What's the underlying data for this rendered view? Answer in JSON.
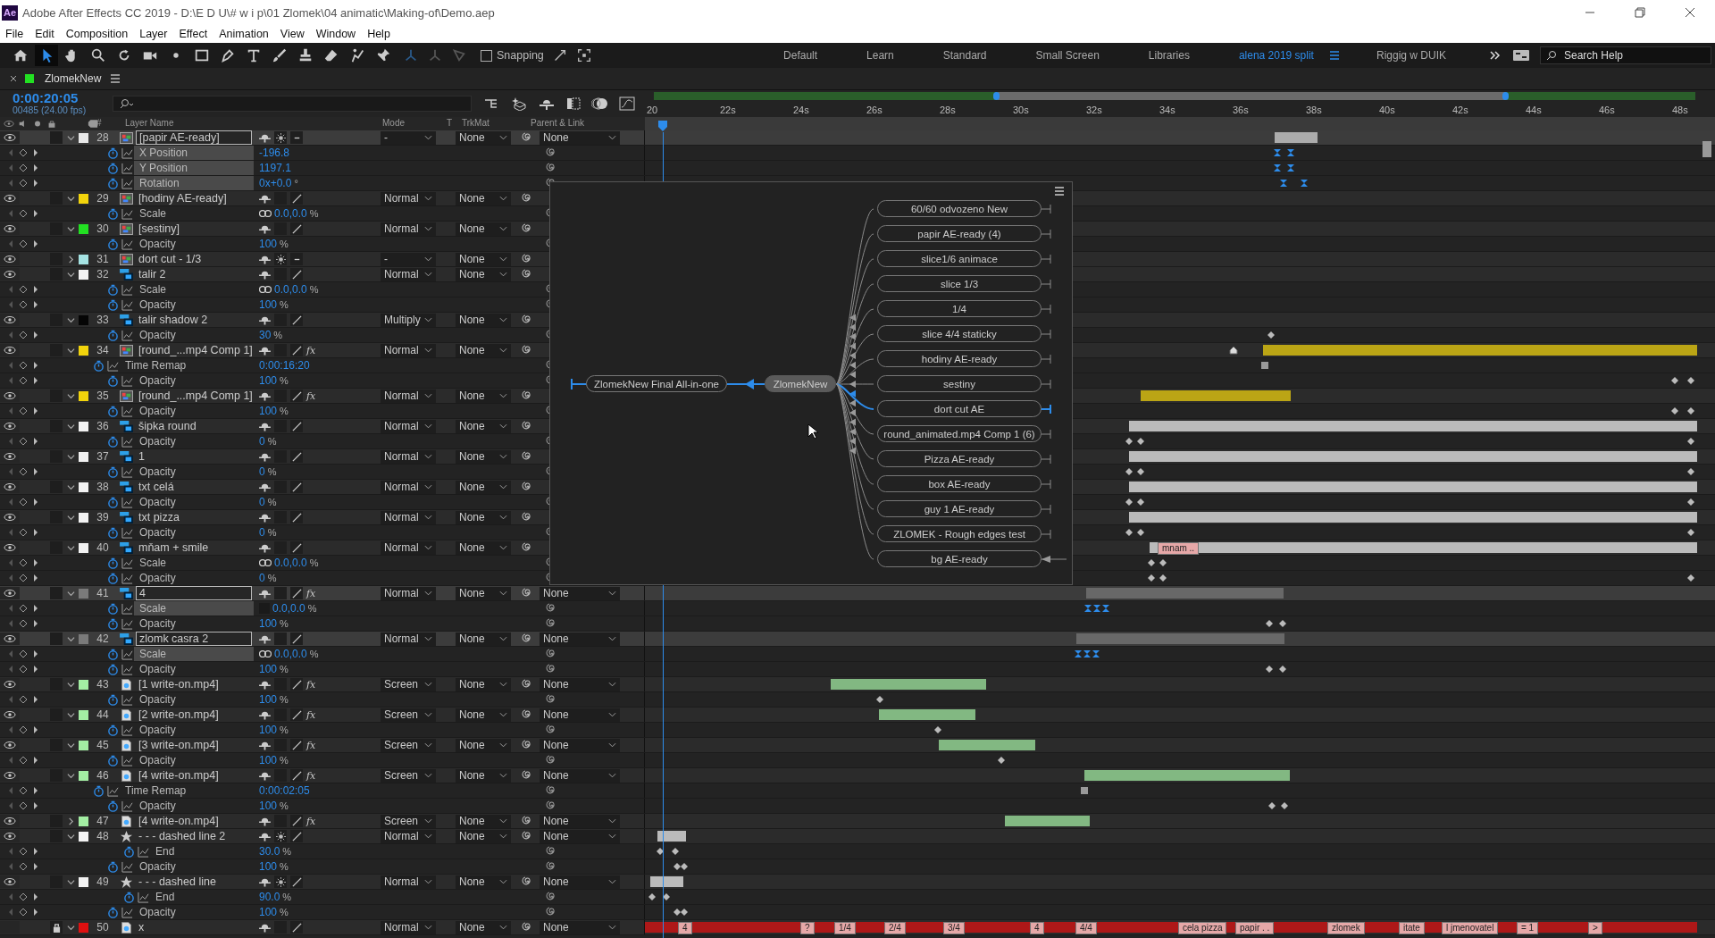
{
  "window": {
    "app_icon": "Ae",
    "title": "Adobe After Effects CC 2019 - D:\\E D U\\# w i p\\01 Zlomek\\04 animatic\\Making-of\\Demo.aep"
  },
  "menu": [
    "File",
    "Edit",
    "Composition",
    "Layer",
    "Effect",
    "Animation",
    "View",
    "Window",
    "Help"
  ],
  "tools": [
    {
      "kind": "home",
      "selected": false
    },
    {
      "kind": "select",
      "selected": true
    },
    {
      "kind": "hand",
      "selected": false
    },
    {
      "kind": "zoom",
      "selected": false
    },
    {
      "kind": "rotate",
      "selected": false
    },
    {
      "kind": "camera",
      "selected": false
    },
    {
      "kind": "pan",
      "selected": false
    },
    {
      "kind": "rectangle",
      "selected": false
    },
    {
      "kind": "pen",
      "selected": false
    },
    {
      "kind": "type",
      "selected": false
    },
    {
      "kind": "brush",
      "selected": false
    },
    {
      "kind": "stamp",
      "selected": false
    },
    {
      "kind": "eraser",
      "selected": false
    },
    {
      "kind": "roto",
      "selected": false
    },
    {
      "kind": "pin",
      "selected": false
    }
  ],
  "snapping": {
    "label": "Snapping",
    "checked": false
  },
  "workspaces": [
    {
      "label": "Default",
      "selected": false
    },
    {
      "label": "Learn",
      "selected": false
    },
    {
      "label": "Standard",
      "selected": false
    },
    {
      "label": "Small Screen",
      "selected": false
    },
    {
      "label": "Libraries",
      "selected": false
    },
    {
      "label": "alena 2019 split",
      "selected": true
    },
    {
      "label": "Riggig w DUIK",
      "selected": false
    }
  ],
  "search_help": {
    "placeholder": "Search Help"
  },
  "comp_tab": {
    "title": "ZlomekNew",
    "color": "#22e022"
  },
  "timecode": "0:00:20:05",
  "frames": "00485 (24.00 fps)",
  "columns": [
    "#",
    "Layer Name",
    "Mode",
    "T",
    "TrkMat",
    "Parent & Link"
  ],
  "ruler": [
    "20",
    "22s",
    "24s",
    "26s",
    "28s",
    "30s",
    "32s",
    "34s",
    "36s",
    "38s",
    "40s",
    "42s",
    "44s",
    "46s",
    "48s"
  ],
  "layers": [
    {
      "number": "28",
      "name": "[papir AE-ready]",
      "color": "#e8e8e8",
      "kind": "comp",
      "expanded": true,
      "visible": true,
      "locked": false,
      "selected": true,
      "collapse": true,
      "quality": false,
      "mode": "-",
      "trkmat": "None",
      "parent": "None",
      "properties": [
        {
          "name": "X Position",
          "kind": "transform",
          "value": "-196.8",
          "selected": true
        },
        {
          "name": "Y Position",
          "kind": "transform",
          "value": "1197.1",
          "selected": true
        },
        {
          "name": "Rotation",
          "kind": "transform",
          "value": "0x+0.0",
          "unit": "°",
          "selected": true
        }
      ]
    },
    {
      "number": "29",
      "name": "[hodiny AE-ready]",
      "color": "#f2d40c",
      "kind": "comp",
      "expanded": true,
      "visible": true,
      "locked": false,
      "selected": false,
      "collapse": false,
      "quality": true,
      "mode": "Normal",
      "trkmat": "None",
      "properties": [
        {
          "name": "Scale",
          "kind": "transform",
          "value": "0.0,0.0",
          "unit": "%",
          "linked": true,
          "selected": false
        }
      ]
    },
    {
      "number": "30",
      "name": "[sestiny]",
      "color": "#22e022",
      "kind": "comp",
      "expanded": true,
      "visible": true,
      "locked": false,
      "selected": false,
      "collapse": false,
      "quality": true,
      "mode": "Normal",
      "trkmat": "None",
      "properties": [
        {
          "name": "Opacity",
          "kind": "transform",
          "value": "100",
          "unit": "%",
          "selected": false
        }
      ]
    },
    {
      "number": "31",
      "name": "dort cut - 1/3",
      "color": "#a5e3e3",
      "kind": "comp",
      "expanded": false,
      "visible": true,
      "locked": false,
      "selected": false,
      "collapse": true,
      "quality": false,
      "mode": "-",
      "trkmat": "None"
    },
    {
      "number": "32",
      "name": "talir 2",
      "color": "#f2f2f2",
      "kind": "psd",
      "expanded": true,
      "visible": true,
      "locked": false,
      "selected": false,
      "collapse": false,
      "quality": true,
      "mode": "Normal",
      "trkmat": "None",
      "properties": [
        {
          "name": "Scale",
          "kind": "transform",
          "value": "0.0,0.0",
          "unit": "%",
          "linked": true,
          "selected": false
        },
        {
          "name": "Opacity",
          "kind": "transform",
          "value": "100",
          "unit": "%",
          "selected": false
        }
      ]
    },
    {
      "number": "33",
      "name": "talir shadow 2",
      "color": "#050505",
      "kind": "psd",
      "expanded": true,
      "visible": true,
      "locked": false,
      "selected": false,
      "collapse": false,
      "quality": true,
      "mode": "Multiply",
      "trkmat": "None",
      "properties": [
        {
          "name": "Opacity",
          "kind": "transform",
          "value": "30",
          "unit": "%",
          "selected": false
        }
      ]
    },
    {
      "number": "34",
      "name": "[round_...mp4 Comp 1]",
      "color": "#f2d40c",
      "kind": "comp",
      "expanded": true,
      "visible": true,
      "locked": false,
      "selected": false,
      "collapse": false,
      "quality": true,
      "fx": "fx",
      "mode": "Normal",
      "trkmat": "None",
      "properties": [
        {
          "name": "Time Remap",
          "kind": "remap",
          "value": "0:00:16:20",
          "selected": false
        },
        {
          "name": "Opacity",
          "kind": "transform",
          "value": "100",
          "unit": "%",
          "selected": false
        }
      ]
    },
    {
      "number": "35",
      "name": "[round_...mp4 Comp 1]",
      "color": "#f2d40c",
      "kind": "comp",
      "expanded": true,
      "visible": true,
      "locked": false,
      "selected": false,
      "collapse": false,
      "quality": true,
      "fx": "fx",
      "mode": "Normal",
      "trkmat": "None",
      "properties": [
        {
          "name": "Opacity",
          "kind": "transform",
          "value": "100",
          "unit": "%",
          "selected": false
        }
      ]
    },
    {
      "number": "36",
      "name": "šipka round",
      "color": "#f2f2f2",
      "kind": "psd",
      "expanded": true,
      "visible": true,
      "locked": false,
      "selected": false,
      "collapse": false,
      "quality": true,
      "mode": "Normal",
      "trkmat": "None",
      "properties": [
        {
          "name": "Opacity",
          "kind": "transform",
          "value": "0",
          "unit": "%",
          "selected": false
        }
      ]
    },
    {
      "number": "37",
      "name": "1",
      "color": "#f2f2f2",
      "kind": "psd",
      "expanded": true,
      "visible": true,
      "locked": false,
      "selected": false,
      "collapse": false,
      "quality": true,
      "mode": "Normal",
      "trkmat": "None",
      "properties": [
        {
          "name": "Opacity",
          "kind": "transform",
          "value": "0",
          "unit": "%",
          "selected": false
        }
      ]
    },
    {
      "number": "38",
      "name": "txt celá",
      "color": "#f2f2f2",
      "kind": "psd",
      "expanded": true,
      "visible": true,
      "locked": false,
      "selected": false,
      "collapse": false,
      "quality": true,
      "mode": "Normal",
      "trkmat": "None",
      "properties": [
        {
          "name": "Opacity",
          "kind": "transform",
          "value": "0",
          "unit": "%",
          "selected": false
        }
      ]
    },
    {
      "number": "39",
      "name": "txt pizza",
      "color": "#f2f2f2",
      "kind": "psd",
      "expanded": true,
      "visible": true,
      "locked": false,
      "selected": false,
      "collapse": false,
      "quality": true,
      "mode": "Normal",
      "trkmat": "None",
      "properties": [
        {
          "name": "Opacity",
          "kind": "transform",
          "value": "0",
          "unit": "%",
          "selected": false
        }
      ]
    },
    {
      "number": "40",
      "name": "mňam + smile",
      "color": "#f2f2f2",
      "kind": "psd",
      "expanded": true,
      "visible": true,
      "locked": false,
      "selected": false,
      "collapse": false,
      "quality": true,
      "mode": "Normal",
      "trkmat": "None",
      "markers": [
        "mnam .."
      ],
      "properties": [
        {
          "name": "Scale",
          "kind": "transform",
          "value": "0.0,0.0",
          "unit": "%",
          "linked": true,
          "selected": false
        },
        {
          "name": "Opacity",
          "kind": "transform",
          "value": "0",
          "unit": "%",
          "selected": false
        }
      ]
    },
    {
      "number": "41",
      "name": "4",
      "color": "#7a7a7a",
      "kind": "psd",
      "expanded": true,
      "visible": true,
      "locked": false,
      "selected": true,
      "collapse": false,
      "quality": true,
      "fx": "fx",
      "mode": "Normal",
      "trkmat": "None",
      "parent": "None",
      "properties": [
        {
          "name": "Scale",
          "kind": "transform",
          "value": "0.0,0.0",
          "unit": "%",
          "linked": false,
          "selected": true
        },
        {
          "name": "Opacity",
          "kind": "transform",
          "value": "100",
          "unit": "%",
          "selected": false
        }
      ]
    },
    {
      "number": "42",
      "name": "zlomk casra 2",
      "color": "#7a7a7a",
      "kind": "psd",
      "expanded": true,
      "visible": true,
      "locked": false,
      "selected": true,
      "collapse": false,
      "quality": true,
      "mode": "Normal",
      "trkmat": "None",
      "parent": "None",
      "properties": [
        {
          "name": "Scale",
          "kind": "transform",
          "value": "0.0,0.0",
          "unit": "%",
          "linked": true,
          "selected": true
        },
        {
          "name": "Opacity",
          "kind": "transform",
          "value": "100",
          "unit": "%",
          "selected": false
        }
      ]
    },
    {
      "number": "43",
      "name": "[1 write-on.mp4]",
      "color": "#a3eea3",
      "kind": "footage",
      "expanded": true,
      "visible": true,
      "locked": false,
      "selected": false,
      "collapse": false,
      "quality": true,
      "fx": "fx",
      "mode": "Screen",
      "trkmat": "None",
      "parent": "None",
      "properties": [
        {
          "name": "Opacity",
          "kind": "transform",
          "value": "100",
          "unit": "%",
          "selected": false
        }
      ]
    },
    {
      "number": "44",
      "name": "[2 write-on.mp4]",
      "color": "#a3eea3",
      "kind": "footage",
      "expanded": true,
      "visible": true,
      "locked": false,
      "selected": false,
      "collapse": false,
      "quality": true,
      "fx": "fx",
      "mode": "Screen",
      "trkmat": "None",
      "parent": "None",
      "properties": [
        {
          "name": "Opacity",
          "kind": "transform",
          "value": "100",
          "unit": "%",
          "selected": false
        }
      ]
    },
    {
      "number": "45",
      "name": "[3 write-on.mp4]",
      "color": "#a3eea3",
      "kind": "footage",
      "expanded": true,
      "visible": true,
      "locked": false,
      "selected": false,
      "collapse": false,
      "quality": true,
      "fx": "fx",
      "mode": "Screen",
      "trkmat": "None",
      "parent": "None",
      "properties": [
        {
          "name": "Opacity",
          "kind": "transform",
          "value": "100",
          "unit": "%",
          "selected": false
        }
      ]
    },
    {
      "number": "46",
      "name": "[4 write-on.mp4]",
      "color": "#a3eea3",
      "kind": "footage",
      "expanded": true,
      "visible": true,
      "locked": false,
      "selected": false,
      "collapse": false,
      "quality": true,
      "fx": "fx",
      "mode": "Screen",
      "trkmat": "None",
      "parent": "None",
      "properties": [
        {
          "name": "Time Remap",
          "kind": "remap",
          "value": "0:00:02:05",
          "selected": false
        },
        {
          "name": "Opacity",
          "kind": "transform",
          "value": "100",
          "unit": "%",
          "selected": false
        }
      ]
    },
    {
      "number": "47",
      "name": "[4 write-on.mp4]",
      "color": "#a3eea3",
      "kind": "footage",
      "expanded": false,
      "visible": true,
      "locked": false,
      "selected": false,
      "collapse": false,
      "quality": true,
      "fx": "fx",
      "mode": "Screen",
      "trkmat": "None",
      "parent": "None"
    },
    {
      "number": "48",
      "name": "- - -  dashed line 2",
      "color": "#f2f2f2",
      "kind": "shape",
      "expanded": true,
      "visible": true,
      "locked": false,
      "selected": false,
      "collapse": true,
      "quality": true,
      "mode": "Normal",
      "trkmat": "None",
      "parent": "None",
      "properties": [
        {
          "name": "End",
          "kind": "trim",
          "value": "30.0",
          "unit": "%",
          "selected": false
        },
        {
          "name": "Opacity",
          "kind": "transform",
          "value": "100",
          "unit": "%",
          "selected": false
        }
      ]
    },
    {
      "number": "49",
      "name": "- - -  dashed line",
      "color": "#f2f2f2",
      "kind": "shape",
      "expanded": true,
      "visible": true,
      "locked": false,
      "selected": false,
      "collapse": true,
      "quality": true,
      "mode": "Normal",
      "trkmat": "None",
      "parent": "None",
      "properties": [
        {
          "name": "End",
          "kind": "trim",
          "value": "90.0",
          "unit": "%",
          "selected": false
        },
        {
          "name": "Opacity",
          "kind": "transform",
          "value": "100",
          "unit": "%",
          "selected": false
        }
      ]
    },
    {
      "number": "50",
      "name": "x",
      "color": "#e01010",
      "kind": "footage",
      "expanded": true,
      "visible": false,
      "locked": true,
      "selected": false,
      "collapse": false,
      "quality": true,
      "mode": "Normal",
      "trkmat": "None",
      "parent": "None",
      "markers": [
        "4",
        "?",
        "1/4",
        "2/4",
        "3/4",
        "4",
        "4/4",
        "cela pizza",
        "papir . .",
        "zlomek",
        "itate",
        "l jmenovatel",
        "= 1",
        ">"
      ]
    }
  ],
  "flowchart": {
    "source": "ZlomekNew Final All-in-one",
    "current": "ZlomekNew",
    "nodes": [
      {
        "label": "60/60 odvozeno New",
        "highlighted": false,
        "kind": "cap"
      },
      {
        "label": "papir AE-ready (4)",
        "highlighted": false,
        "kind": "cap"
      },
      {
        "label": "slice1/6 animace",
        "highlighted": false,
        "kind": "cap"
      },
      {
        "label": "slice 1/3",
        "highlighted": false,
        "kind": "cap"
      },
      {
        "label": "1/4",
        "highlighted": false,
        "kind": "cap"
      },
      {
        "label": "slice 4/4 staticky",
        "highlighted": false,
        "kind": "cap"
      },
      {
        "label": "hodiny AE-ready",
        "highlighted": false,
        "kind": "cap"
      },
      {
        "label": "sestiny",
        "highlighted": false,
        "kind": "cap"
      },
      {
        "label": "dort cut AE",
        "highlighted": true,
        "kind": "cap"
      },
      {
        "label": "round_animated.mp4 Comp 1 (6)",
        "highlighted": false,
        "kind": "cap"
      },
      {
        "label": "Pizza AE-ready",
        "highlighted": false,
        "kind": "cap"
      },
      {
        "label": "box AE-ready",
        "highlighted": false,
        "kind": "cap"
      },
      {
        "label": "guy 1 AE-ready",
        "highlighted": false,
        "kind": "cap"
      },
      {
        "label": "ZLOMEK - Rough edges test",
        "highlighted": false,
        "kind": "cap"
      },
      {
        "label": "bg AE-ready",
        "highlighted": false,
        "kind": "arrow"
      }
    ]
  }
}
